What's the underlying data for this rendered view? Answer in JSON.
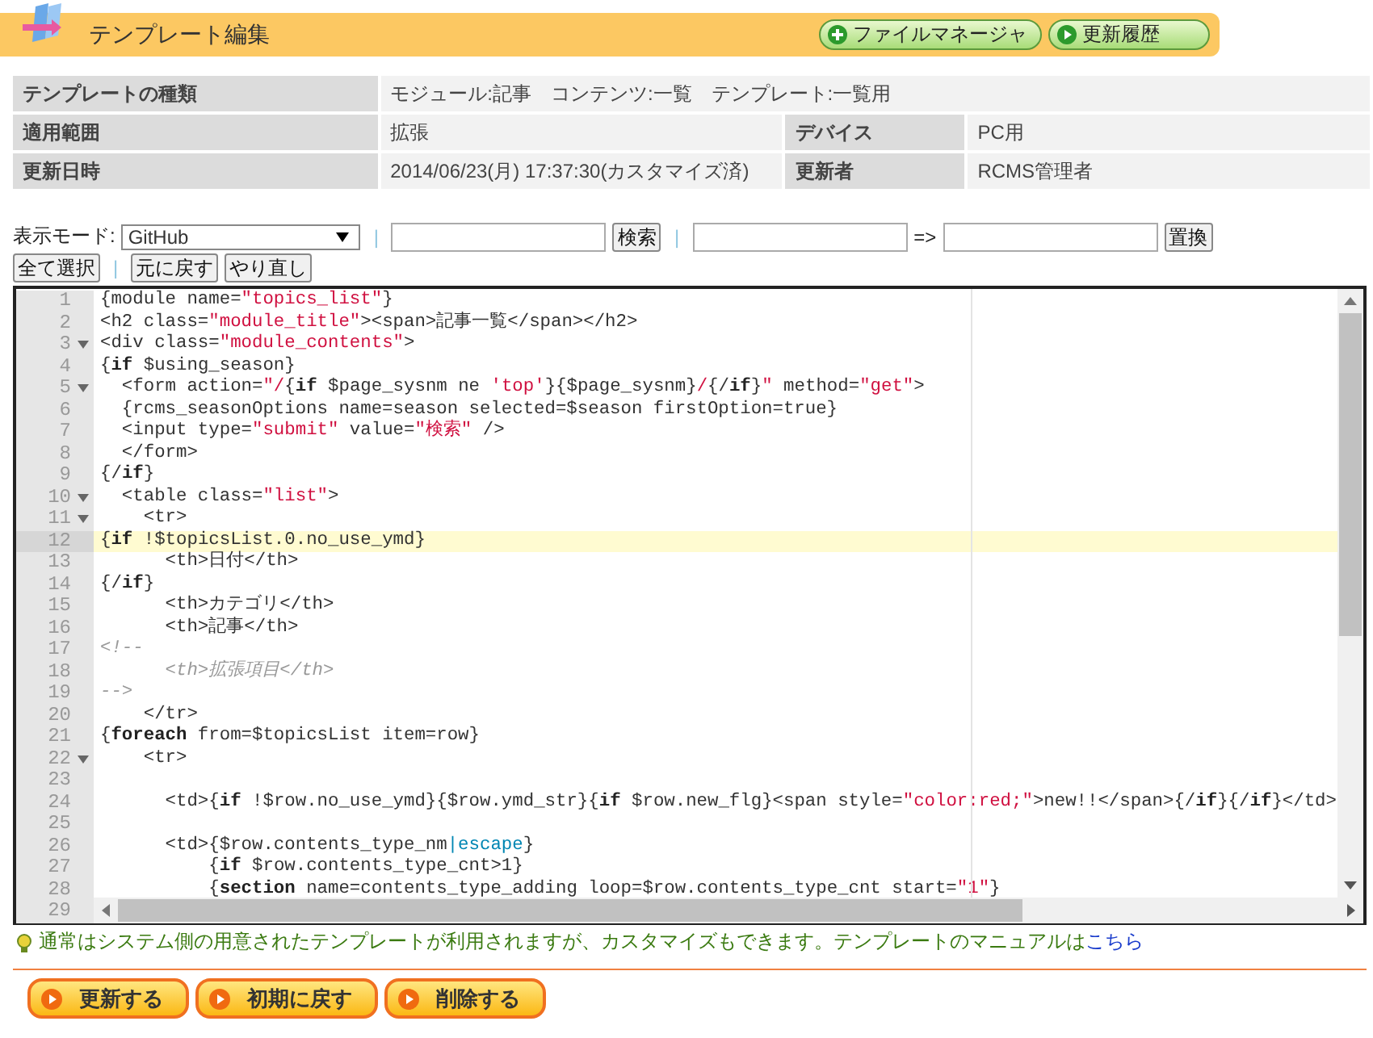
{
  "header": {
    "title": "テンプレート編集",
    "buttons": [
      "ファイルマネージャ",
      "更新履歴"
    ]
  },
  "info": {
    "rows": [
      [
        {
          "label": "テンプレートの種類",
          "value": "モジュール:記事　コンテンツ:一覧　テンプレート:一覧用"
        }
      ],
      [
        {
          "label": "適用範囲",
          "value": "拡張"
        },
        {
          "label": "デバイス",
          "value": "PC用"
        }
      ],
      [
        {
          "label": "更新日時",
          "value": "2014/06/23(月) 17:37:30(カスタマイズ済)"
        },
        {
          "label": "更新者",
          "value": "RCMS管理者"
        }
      ]
    ]
  },
  "search_bar": [
    {
      "kind": "label",
      "text": "表示モード:"
    },
    {
      "kind": "select",
      "value": "GitHub"
    },
    {
      "kind": "separator",
      "text": "|"
    },
    {
      "kind": "input"
    },
    {
      "kind": "button",
      "text": "検索"
    },
    {
      "kind": "separator",
      "text": "|"
    },
    {
      "kind": "input"
    },
    {
      "kind": "label",
      "text": "=>"
    },
    {
      "kind": "input"
    },
    {
      "kind": "button",
      "text": "置換"
    }
  ],
  "edit_bar": [
    {
      "kind": "button",
      "text": "全て選択"
    },
    {
      "kind": "separator",
      "text": "|"
    },
    {
      "kind": "button",
      "text": "元に戻す"
    },
    {
      "kind": "button",
      "text": "やり直し"
    }
  ],
  "editor": {
    "lines": [
      {
        "number": "1",
        "foldable": false,
        "active": false,
        "tokens": [
          {
            "kind": "plain",
            "text": "{module name="
          },
          {
            "kind": "string",
            "text": "\"topics_list\""
          },
          {
            "kind": "plain",
            "text": "}"
          }
        ]
      },
      {
        "number": "2",
        "foldable": false,
        "active": false,
        "tokens": [
          {
            "kind": "plain",
            "text": "<h2 class="
          },
          {
            "kind": "string",
            "text": "\"module_title\""
          },
          {
            "kind": "plain",
            "text": "><span>記事一覧</span></h2>"
          }
        ]
      },
      {
        "number": "3",
        "foldable": true,
        "active": false,
        "tokens": [
          {
            "kind": "plain",
            "text": "<div class="
          },
          {
            "kind": "string",
            "text": "\"module_contents\""
          },
          {
            "kind": "plain",
            "text": ">"
          }
        ]
      },
      {
        "number": "4",
        "foldable": false,
        "active": false,
        "tokens": [
          {
            "kind": "plain",
            "text": "{"
          },
          {
            "kind": "keyword",
            "text": "if"
          },
          {
            "kind": "plain",
            "text": " $using_season}"
          }
        ]
      },
      {
        "number": "5",
        "foldable": true,
        "active": false,
        "tokens": [
          {
            "kind": "plain",
            "text": "  <form action="
          },
          {
            "kind": "string",
            "text": "\"/"
          },
          {
            "kind": "plain",
            "text": "{"
          },
          {
            "kind": "keyword",
            "text": "if"
          },
          {
            "kind": "plain",
            "text": " $page_sysnm ne "
          },
          {
            "kind": "string",
            "text": "'top'"
          },
          {
            "kind": "plain",
            "text": "}{$page_sysnm}"
          },
          {
            "kind": "string",
            "text": "/"
          },
          {
            "kind": "plain",
            "text": "{/"
          },
          {
            "kind": "keyword",
            "text": "if"
          },
          {
            "kind": "plain",
            "text": "}"
          },
          {
            "kind": "string",
            "text": "\""
          },
          {
            "kind": "plain",
            "text": " method="
          },
          {
            "kind": "string",
            "text": "\"get\""
          },
          {
            "kind": "plain",
            "text": ">"
          }
        ]
      },
      {
        "number": "6",
        "foldable": false,
        "active": false,
        "tokens": [
          {
            "kind": "plain",
            "text": "  {rcms_seasonOptions name=season selected=$season firstOption=true}"
          }
        ]
      },
      {
        "number": "7",
        "foldable": false,
        "active": false,
        "tokens": [
          {
            "kind": "plain",
            "text": "  <input type="
          },
          {
            "kind": "string",
            "text": "\"submit\""
          },
          {
            "kind": "plain",
            "text": " value="
          },
          {
            "kind": "string",
            "text": "\"検索\""
          },
          {
            "kind": "plain",
            "text": " />"
          }
        ]
      },
      {
        "number": "8",
        "foldable": false,
        "active": false,
        "tokens": [
          {
            "kind": "plain",
            "text": "  </form>"
          }
        ]
      },
      {
        "number": "9",
        "foldable": false,
        "active": false,
        "tokens": [
          {
            "kind": "plain",
            "text": "{/"
          },
          {
            "kind": "keyword",
            "text": "if"
          },
          {
            "kind": "plain",
            "text": "}"
          }
        ]
      },
      {
        "number": "10",
        "foldable": true,
        "active": false,
        "tokens": [
          {
            "kind": "plain",
            "text": "  <table class="
          },
          {
            "kind": "string",
            "text": "\"list\""
          },
          {
            "kind": "plain",
            "text": ">"
          }
        ]
      },
      {
        "number": "11",
        "foldable": true,
        "active": false,
        "tokens": [
          {
            "kind": "plain",
            "text": "    <tr>"
          }
        ]
      },
      {
        "number": "12",
        "foldable": false,
        "active": true,
        "tokens": [
          {
            "kind": "plain",
            "text": "{"
          },
          {
            "kind": "keyword",
            "text": "if"
          },
          {
            "kind": "plain",
            "text": " !$topicsList.0.no_use_ymd}"
          }
        ]
      },
      {
        "number": "13",
        "foldable": false,
        "active": false,
        "tokens": [
          {
            "kind": "plain",
            "text": "      <th>日付</th>"
          }
        ]
      },
      {
        "number": "14",
        "foldable": false,
        "active": false,
        "tokens": [
          {
            "kind": "plain",
            "text": "{/"
          },
          {
            "kind": "keyword",
            "text": "if"
          },
          {
            "kind": "plain",
            "text": "}"
          }
        ]
      },
      {
        "number": "15",
        "foldable": false,
        "active": false,
        "tokens": [
          {
            "kind": "plain",
            "text": "      <th>カテゴリ</th>"
          }
        ]
      },
      {
        "number": "16",
        "foldable": false,
        "active": false,
        "tokens": [
          {
            "kind": "plain",
            "text": "      <th>記事</th>"
          }
        ]
      },
      {
        "number": "17",
        "foldable": false,
        "active": false,
        "tokens": [
          {
            "kind": "comment",
            "text": "<!--"
          }
        ]
      },
      {
        "number": "18",
        "foldable": false,
        "active": false,
        "tokens": [
          {
            "kind": "comment",
            "text": "      <th>拡張項目</th>"
          }
        ]
      },
      {
        "number": "19",
        "foldable": false,
        "active": false,
        "tokens": [
          {
            "kind": "comment",
            "text": "-->"
          }
        ]
      },
      {
        "number": "20",
        "foldable": false,
        "active": false,
        "tokens": [
          {
            "kind": "plain",
            "text": "    </tr>"
          }
        ]
      },
      {
        "number": "21",
        "foldable": false,
        "active": false,
        "tokens": [
          {
            "kind": "plain",
            "text": "{"
          },
          {
            "kind": "keyword",
            "text": "foreach"
          },
          {
            "kind": "plain",
            "text": " from=$topicsList item=row}"
          }
        ]
      },
      {
        "number": "22",
        "foldable": true,
        "active": false,
        "tokens": [
          {
            "kind": "plain",
            "text": "    <tr>"
          }
        ]
      },
      {
        "number": "23",
        "foldable": false,
        "active": false
      },
      {
        "number": "24",
        "foldable": false,
        "active": false,
        "tokens": [
          {
            "kind": "plain",
            "text": "      <td>{"
          },
          {
            "kind": "keyword",
            "text": "if"
          },
          {
            "kind": "plain",
            "text": " !$row.no_use_ymd}{$row.ymd_str}{"
          },
          {
            "kind": "keyword",
            "text": "if"
          },
          {
            "kind": "plain",
            "text": " $row.new_flg}<span style="
          },
          {
            "kind": "string",
            "text": "\"color:red;\""
          },
          {
            "kind": "plain",
            "text": ">new!!</span>{/"
          },
          {
            "kind": "keyword",
            "text": "if"
          },
          {
            "kind": "plain",
            "text": "}{/"
          },
          {
            "kind": "keyword",
            "text": "if"
          },
          {
            "kind": "plain",
            "text": "}</td>"
          }
        ]
      },
      {
        "number": "25",
        "foldable": false,
        "active": false
      },
      {
        "number": "26",
        "foldable": false,
        "active": false,
        "tokens": [
          {
            "kind": "plain",
            "text": "      <td>{$row.contents_type_nm"
          },
          {
            "kind": "filter",
            "text": "|escape"
          },
          {
            "kind": "plain",
            "text": "}"
          }
        ]
      },
      {
        "number": "27",
        "foldable": false,
        "active": false,
        "tokens": [
          {
            "kind": "plain",
            "text": "          {"
          },
          {
            "kind": "keyword",
            "text": "if"
          },
          {
            "kind": "plain",
            "text": " $row.contents_type_cnt>1}"
          }
        ]
      },
      {
        "number": "28",
        "foldable": false,
        "active": false,
        "tokens": [
          {
            "kind": "plain",
            "text": "          {"
          },
          {
            "kind": "keyword",
            "text": "section"
          },
          {
            "kind": "plain",
            "text": " name=contents_type_adding loop=$row.contents_type_cnt start="
          },
          {
            "kind": "string",
            "text": "\"1\""
          },
          {
            "kind": "plain",
            "text": "}"
          }
        ]
      },
      {
        "number": "29",
        "foldable": false,
        "active": false
      }
    ]
  },
  "hint": {
    "text": "通常はシステム側の用意されたテンプレートが利用されますが、カスタマイズもできます。テンプレートのマニュアルは",
    "link": "こちら"
  },
  "actions": [
    "更新する",
    "初期に戻す",
    "削除する"
  ]
}
